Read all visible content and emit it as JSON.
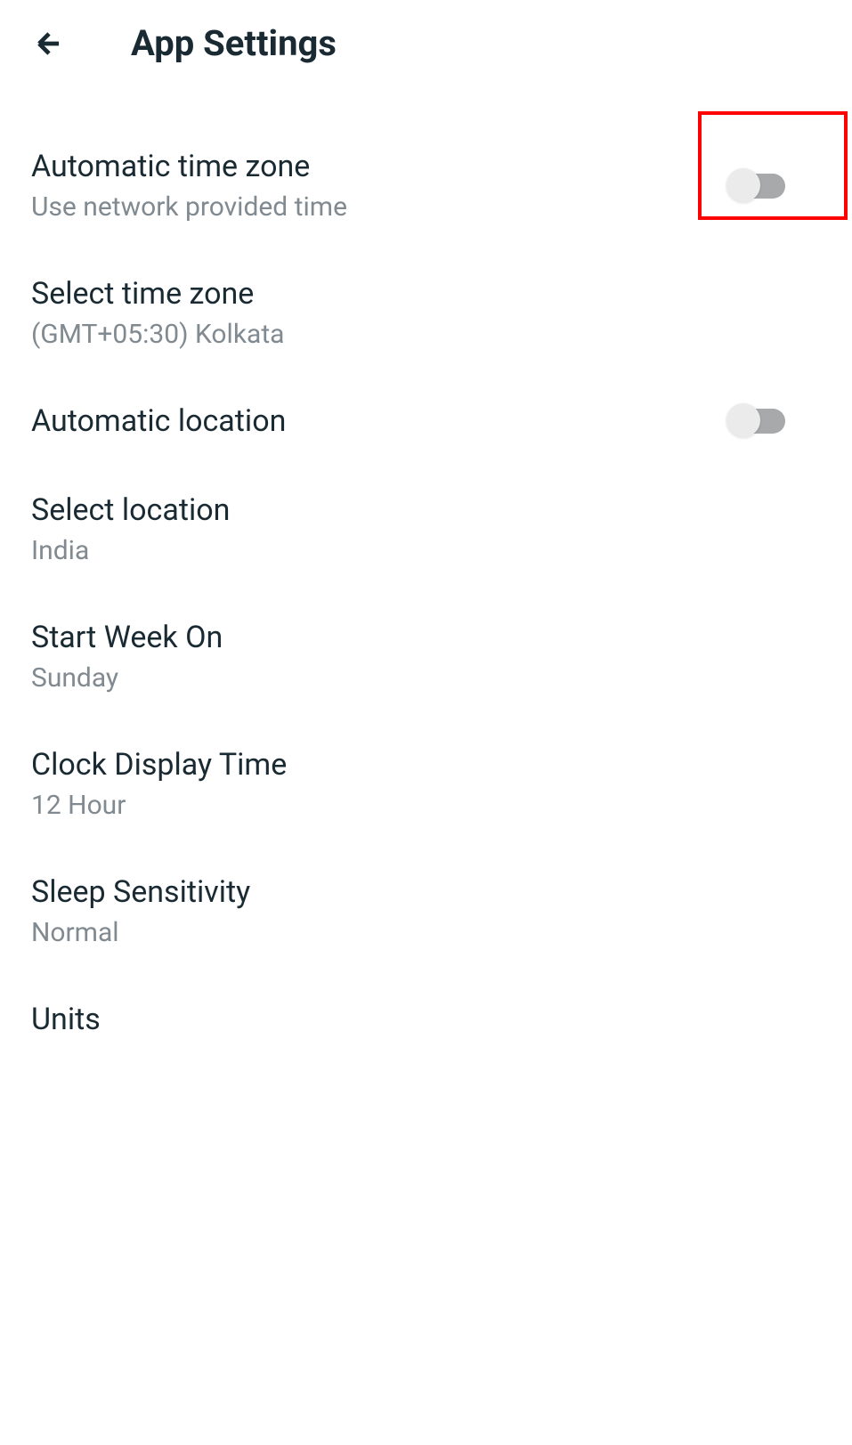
{
  "header": {
    "title": "App Settings"
  },
  "settings": {
    "automaticTimeZone": {
      "label": "Automatic time zone",
      "sublabel": "Use network provided time",
      "value": false
    },
    "selectTimeZone": {
      "label": "Select time zone",
      "sublabel": "(GMT+05:30) Kolkata"
    },
    "automaticLocation": {
      "label": "Automatic location",
      "value": false
    },
    "selectLocation": {
      "label": "Select location",
      "sublabel": "India"
    },
    "startWeekOn": {
      "label": "Start Week On",
      "sublabel": "Sunday"
    },
    "clockDisplayTime": {
      "label": "Clock Display Time",
      "sublabel": "12 Hour"
    },
    "sleepSensitivity": {
      "label": "Sleep Sensitivity",
      "sublabel": "Normal"
    },
    "units": {
      "label": "Units"
    }
  },
  "highlight": {
    "color": "#ff0000"
  }
}
